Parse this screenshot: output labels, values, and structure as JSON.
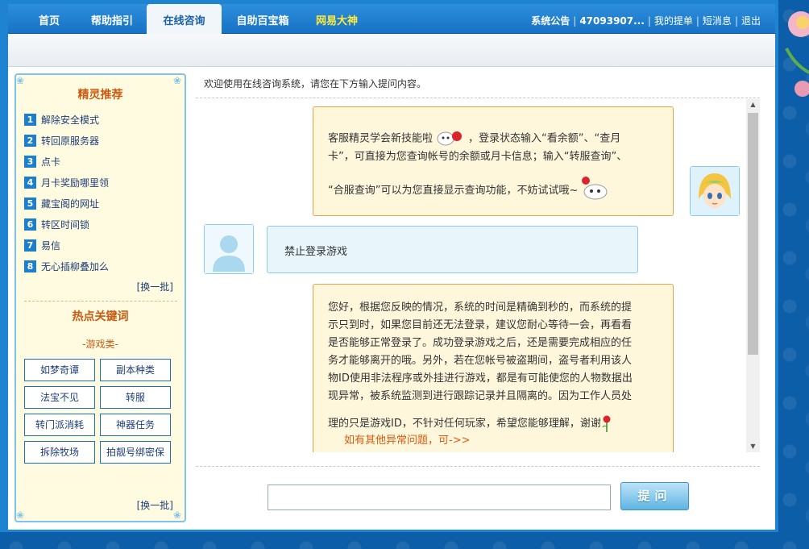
{
  "nav": {
    "items": [
      {
        "label": "首页"
      },
      {
        "label": "帮助指引"
      },
      {
        "label": "在线咨询"
      },
      {
        "label": "自助百宝箱"
      },
      {
        "label": "网易大神"
      }
    ],
    "right": {
      "announcement": "系统公告",
      "account": "47093907...",
      "my_tickets": "我的提单",
      "messages": "短消息",
      "logout": "退出"
    }
  },
  "left": {
    "recommend_title": "精灵推荐",
    "recommend_items": [
      {
        "num": "1",
        "label": "解除安全模式"
      },
      {
        "num": "2",
        "label": "转回原服务器"
      },
      {
        "num": "3",
        "label": "点卡"
      },
      {
        "num": "4",
        "label": "月卡奖励哪里领"
      },
      {
        "num": "5",
        "label": "藏宝阁的网址"
      },
      {
        "num": "6",
        "label": "转区时间锁"
      },
      {
        "num": "7",
        "label": "易信"
      },
      {
        "num": "8",
        "label": "无心插柳叠加么"
      }
    ],
    "refresh_label": "[换一批]",
    "hot_title": "热点关键词",
    "category": "-游戏类-",
    "keywords": [
      "如梦奇谭",
      "副本种类",
      "法宝不见",
      "转服",
      "转门派消耗",
      "神器任务",
      "拆除牧场",
      "拍靓号绑密保"
    ],
    "refresh_label2": "[换一批]"
  },
  "chat": {
    "welcome": "欢迎使用在线咨询系统，请您在下方输入提问内容。",
    "messages": [
      {
        "role": "system",
        "line1a": "客服精灵学会新技能啦",
        "line1b": "，登录状态输入“看余额”、“查月",
        "line2": "卡”，可直接为您查询帐号的余额或月卡信息；输入“转服查询”、",
        "line3": "“合服查询”可以为您直接显示查询功能，不妨试试哦~"
      },
      {
        "role": "user",
        "text": "禁止登录游戏"
      },
      {
        "role": "system",
        "lines": [
          "您好，根据您反映的情况，系统的时间是精确到秒的，而系统的提",
          "示只到时，如果您目前还无法登录，建议您耐心等待一会，再看看",
          "是否能够正常登录了。成功登录游戏之后，还是需要完成相应的任",
          "务才能够离开的哦。另外，若在您帐号被盗期间，盗号者利用该人",
          "物ID使用非法程序或外挂进行游戏，都是有可能使您的人物数据出",
          "现异常，被系统监测到进行跟踪记录并且隔离的。因为工作人员处"
        ],
        "last_line": "理的只是游戏ID，不针对任何玩家，希望您能够理解，谢谢",
        "follow_link": "如有其他异常问题，可->>"
      }
    ],
    "input_value": "",
    "ask_label": "提问"
  },
  "colors": {
    "nav_bg": "#1e84d2",
    "accent_orange": "#c95a12",
    "link_blue": "#1e3e78",
    "num_blue": "#1a7fcf",
    "special_nav": "#ffea3b"
  }
}
